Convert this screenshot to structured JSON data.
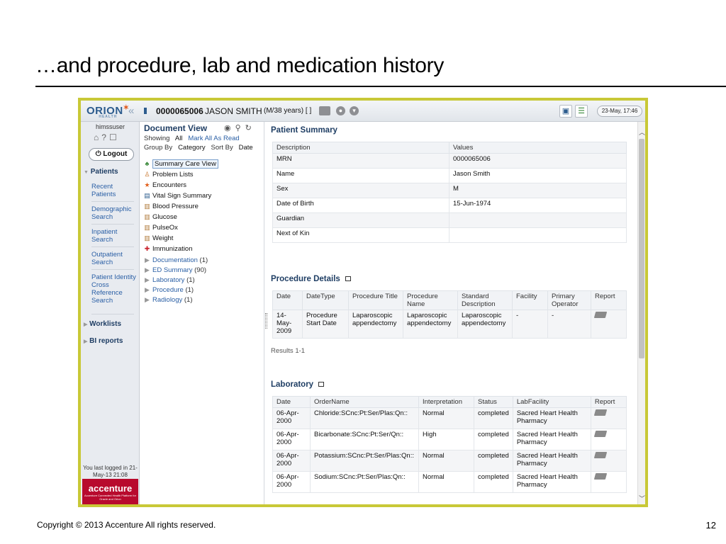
{
  "slide": {
    "title": "…and procedure, lab and medication history",
    "copyright": "Copyright © 2013 Accenture  All rights reserved.",
    "page_number": "12"
  },
  "app": {
    "logo": "ORION",
    "logo_sub": "HEALTH",
    "patient_id": "0000065006",
    "patient_name": "JASON SMITH",
    "patient_age": "(M/38 years) [ ]",
    "datetime": "23-May, 17:46"
  },
  "nav": {
    "username": "himssuser",
    "logout_label": "Logout",
    "patients_label": "Patients",
    "links": [
      "Recent Patients",
      "Demographic Search",
      "Inpatient Search",
      "Outpatient Search",
      "Patient Identity Cross Reference Search"
    ],
    "worklists_label": "Worklists",
    "bi_reports_label": "BI reports",
    "last_login": "You last logged in 21-May-13 21:08",
    "brand": "accenture",
    "brand_sub": "Accenture Connected Health Platform for Oracle and Orion"
  },
  "docview": {
    "title": "Document View",
    "showing_label": "Showing",
    "showing_value": "All",
    "mark_read": "Mark All As Read",
    "group_by_label": "Group By",
    "group_by_value": "Category",
    "sort_by_label": "Sort By",
    "sort_by_value": "Date",
    "items": [
      {
        "label": "Summary Care View"
      },
      {
        "label": "Problem Lists"
      },
      {
        "label": "Encounters"
      },
      {
        "label": "Vital Sign Summary"
      },
      {
        "label": "Blood Pressure"
      },
      {
        "label": "Glucose"
      },
      {
        "label": "PulseOx"
      },
      {
        "label": "Weight"
      },
      {
        "label": "Immunization"
      }
    ],
    "folders": [
      {
        "label": "Documentation",
        "count": "(1)"
      },
      {
        "label": "ED Summary",
        "count": "(90)"
      },
      {
        "label": "Laboratory",
        "count": "(1)"
      },
      {
        "label": "Procedure",
        "count": "(1)"
      },
      {
        "label": "Radiology",
        "count": "(1)"
      }
    ]
  },
  "patient_summary": {
    "title": "Patient Summary",
    "headers": [
      "Description",
      "Values"
    ],
    "rows": [
      [
        "MRN",
        "0000065006"
      ],
      [
        "Name",
        "Jason Smith"
      ],
      [
        "Sex",
        "M"
      ],
      [
        "Date of Birth",
        "15-Jun-1974"
      ],
      [
        "Guardian",
        ""
      ],
      [
        "Next of Kin",
        ""
      ]
    ]
  },
  "procedure": {
    "title": "Procedure Details",
    "headers": [
      "Date",
      "DateType",
      "Procedure Title",
      "Procedure Name",
      "Standard Description",
      "Facility",
      "Primary Operator",
      "Report"
    ],
    "row": [
      "14-May-2009",
      "Procedure Start Date",
      "Laparoscopic appendectomy",
      "Laparoscopic appendectomy",
      "Laparoscopic appendectomy",
      "-",
      "-"
    ],
    "results": "Results 1-1"
  },
  "laboratory": {
    "title": "Laboratory",
    "headers": [
      "Date",
      "OrderName",
      "Interpretation",
      "Status",
      "LabFacility",
      "Report"
    ],
    "rows": [
      [
        "06-Apr-2000",
        "Chloride:SCnc:Pt:Ser/Plas:Qn::",
        "Normal",
        "completed",
        "Sacred Heart Health Pharmacy"
      ],
      [
        "06-Apr-2000",
        "Bicarbonate:SCnc:Pt:Ser/Qn::",
        "High",
        "completed",
        "Sacred Heart Health Pharmacy"
      ],
      [
        "06-Apr-2000",
        "Potassium:SCnc:Pt:Ser/Plas:Qn::",
        "Normal",
        "completed",
        "Sacred Heart Health Pharmacy"
      ],
      [
        "06-Apr-2000",
        "Sodium:SCnc:Pt:Ser/Plas:Qn::",
        "Normal",
        "completed",
        "Sacred Heart Health Pharmacy"
      ]
    ]
  }
}
